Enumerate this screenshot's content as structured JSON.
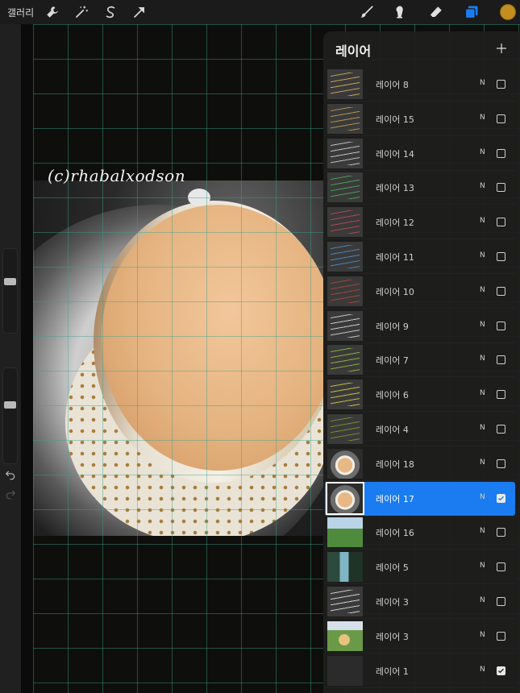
{
  "toolbar": {
    "gallery_label": "갤러리",
    "left_icons": [
      "wrench-icon",
      "magic-wand-icon",
      "selection-icon",
      "transform-arrow-icon"
    ],
    "right_icons": [
      "brush-icon",
      "smudge-icon",
      "eraser-icon",
      "layers-icon"
    ],
    "current_color": "#c38e1f",
    "accent_color": "#1a7cf0"
  },
  "canvas": {
    "watermark": "(c)rhabalxodson"
  },
  "sidebar": {
    "brush_size_level": 0.62,
    "opacity_level": 0.05
  },
  "layers_panel": {
    "title": "레이어",
    "layers": [
      {
        "name": "레이어 8",
        "blend": "N",
        "visible": false,
        "thumb": "script",
        "ink": "#d9b35a"
      },
      {
        "name": "레이어 15",
        "blend": "N",
        "visible": false,
        "thumb": "script",
        "ink": "#c6a24d"
      },
      {
        "name": "레이어 14",
        "blend": "N",
        "visible": false,
        "thumb": "script",
        "ink": "#d8d8d8"
      },
      {
        "name": "레이어 13",
        "blend": "N",
        "visible": false,
        "thumb": "script",
        "ink": "#4fae58"
      },
      {
        "name": "레이어 12",
        "blend": "N",
        "visible": false,
        "thumb": "script",
        "ink": "#c2485c"
      },
      {
        "name": "레이어 11",
        "blend": "N",
        "visible": false,
        "thumb": "script",
        "ink": "#4b8fd2"
      },
      {
        "name": "레이어 10",
        "blend": "N",
        "visible": false,
        "thumb": "script",
        "ink": "#b5463d"
      },
      {
        "name": "레이어 9",
        "blend": "N",
        "visible": false,
        "thumb": "script",
        "ink": "#e0e0e0"
      },
      {
        "name": "레이어 7",
        "blend": "N",
        "visible": false,
        "thumb": "script",
        "ink": "#9bbf3c"
      },
      {
        "name": "레이어 6",
        "blend": "N",
        "visible": false,
        "thumb": "script",
        "ink": "#e2d23a"
      },
      {
        "name": "레이어 4",
        "blend": "N",
        "visible": false,
        "thumb": "script",
        "ink": "#7f9a2e"
      },
      {
        "name": "레이어 18",
        "blend": "N",
        "visible": false,
        "thumb": "cup",
        "ink": ""
      },
      {
        "name": "레이어 17",
        "blend": "N",
        "visible": true,
        "thumb": "cup",
        "ink": "",
        "selected": true
      },
      {
        "name": "레이어 16",
        "blend": "N",
        "visible": false,
        "thumb": "green",
        "ink": ""
      },
      {
        "name": "레이어 5",
        "blend": "N",
        "visible": false,
        "thumb": "window",
        "ink": ""
      },
      {
        "name": "레이어 3",
        "blend": "N",
        "visible": false,
        "thumb": "script",
        "ink": "#e8e8e8"
      },
      {
        "name": "레이어 3",
        "blend": "N",
        "visible": false,
        "thumb": "field",
        "ink": ""
      },
      {
        "name": "레이어 1",
        "blend": "N",
        "visible": true,
        "thumb": "dark",
        "ink": ""
      }
    ]
  }
}
